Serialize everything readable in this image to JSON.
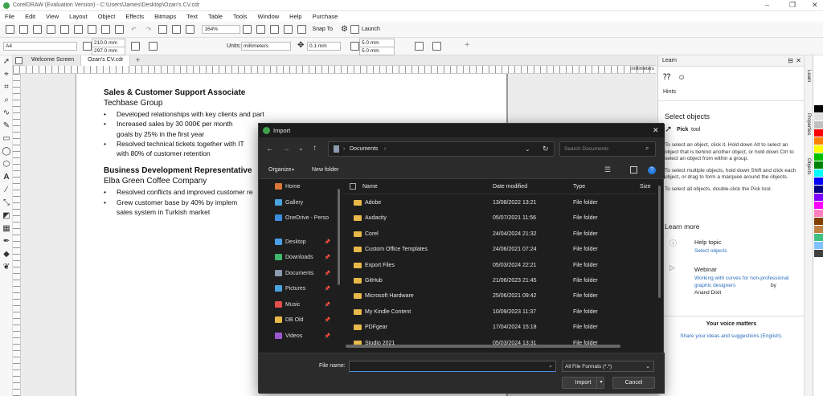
{
  "window": {
    "title": "CorelDRAW (Evaluation Version) - C:\\Users\\James\\Desktop\\Ozan's CV.cdr"
  },
  "menu": [
    "File",
    "Edit",
    "View",
    "Layout",
    "Object",
    "Effects",
    "Bitmaps",
    "Text",
    "Table",
    "Tools",
    "Window",
    "Help",
    "Purchase"
  ],
  "toolbar": {
    "zoom": "164%",
    "snap_to": "Snap To",
    "launch": "Launch"
  },
  "propbar": {
    "page_size": "A4",
    "width": "210.0 mm",
    "height": "297.0 mm",
    "units_label": "Units:",
    "units": "millimeters",
    "nudge": "0.1 mm",
    "dup_x": "5.0 mm",
    "dup_y": "5.0 mm"
  },
  "tabs": [
    "Welcome Screen",
    "Ozan's CV.cdr"
  ],
  "ruler": {
    "units": "millimeters"
  },
  "document": {
    "job1_title": "Sales & Customer Support Associate",
    "job1_company": "Techbase Group",
    "job1_bullets": [
      "Developed relationships with key clients and part",
      "Increased sales by 30 000€ per month",
      "goals by 25% in the first year",
      "Resolved technical tickets together with IT",
      "with 80% of customer retention"
    ],
    "job2_title": "Business Development Representative",
    "job2_company": "Elba Green Coffee Company",
    "job2_bullets": [
      "Resolved conflicts and improved customer re",
      "Grew customer base by 40% by implem",
      "sales system in Turkish market"
    ]
  },
  "learn": {
    "panel_title": "Learn",
    "hints_label": "Hints",
    "section_title": "Select objects",
    "tool_name": "Pick",
    "tool_suffix": "tool",
    "bullets": [
      "To select an object, click it. Hold down Alt to select an object that is behind another object, or hold down Ctrl to select an object from within a group.",
      "To select multiple objects, hold down Shift and click each object, or drag to form a marquee around the objects.",
      "To select all objects, double-click the Pick tool."
    ],
    "learn_more": "Learn more",
    "help_topic_title": "Help topic",
    "help_topic_link": "Select objects",
    "webinar_title": "Webinar",
    "webinar_link": "Working with curves for non-professional graphic designers",
    "webinar_by": "by",
    "webinar_author": "Anand Dixit",
    "voice_title": "Your voice matters",
    "voice_link": "Share your ideas and suggestions (English).",
    "docker_tabs": [
      "Learn",
      "Properties",
      "Objects"
    ]
  },
  "palette": [
    "#ffffff",
    "#000000",
    "#e0e0e0",
    "#c0c0c0",
    "#ff0000",
    "#ff8000",
    "#ffff00",
    "#00c000",
    "#008000",
    "#00ffff",
    "#0000ff",
    "#000080",
    "#8000ff",
    "#ff00ff",
    "#ff80c0",
    "#804000",
    "#c08040",
    "#40c080",
    "#80c0ff",
    "#404040"
  ],
  "dialog": {
    "title": "Import",
    "path": [
      "Documents"
    ],
    "search_placeholder": "Search Documents",
    "organize": "Organize",
    "new_folder": "New folder",
    "nav": [
      {
        "label": "Home",
        "color": "#d9773b",
        "pin": false
      },
      {
        "label": "Gallery",
        "color": "#4aa3df",
        "pin": false
      },
      {
        "label": "OneDrive - Perso",
        "color": "#3c8ee0",
        "pin": false
      },
      {
        "label": "Desktop",
        "color": "#4a9fe8",
        "pin": true
      },
      {
        "label": "Downloads",
        "color": "#3fb86b",
        "pin": true
      },
      {
        "label": "Documents",
        "color": "#8c9aae",
        "pin": true
      },
      {
        "label": "Pictures",
        "color": "#4aa3df",
        "pin": true
      },
      {
        "label": "Music",
        "color": "#e0504a",
        "pin": true
      },
      {
        "label": "DB Old",
        "color": "#e8b84a",
        "pin": true
      },
      {
        "label": "Videos",
        "color": "#9b59d0",
        "pin": true
      }
    ],
    "columns": {
      "name": "Name",
      "date": "Date modified",
      "type": "Type",
      "size": "Size"
    },
    "files": [
      {
        "name": "Adobe",
        "date": "13/08/2022 13:21",
        "type": "File folder"
      },
      {
        "name": "Audacity",
        "date": "05/07/2021 11:56",
        "type": "File folder"
      },
      {
        "name": "Corel",
        "date": "24/04/2024 21:32",
        "type": "File folder"
      },
      {
        "name": "Custom Office Templates",
        "date": "24/06/2021 07:24",
        "type": "File folder"
      },
      {
        "name": "Export Files",
        "date": "05/03/2024 22:21",
        "type": "File folder"
      },
      {
        "name": "GitHub",
        "date": "21/06/2023 21:45",
        "type": "File folder"
      },
      {
        "name": "Microsoft Hardware",
        "date": "25/06/2021 09:42",
        "type": "File folder"
      },
      {
        "name": "My Kindle Content",
        "date": "10/09/2023 11:37",
        "type": "File folder"
      },
      {
        "name": "PDFgear",
        "date": "17/04/2024 15:18",
        "type": "File folder"
      },
      {
        "name": "Studio 2021",
        "date": "05/03/2024 13:31",
        "type": "File folder"
      }
    ],
    "filename_label": "File name:",
    "filename_value": "",
    "filter": "All File Formats (*.*)",
    "import_button": "Import",
    "cancel_button": "Cancel"
  }
}
